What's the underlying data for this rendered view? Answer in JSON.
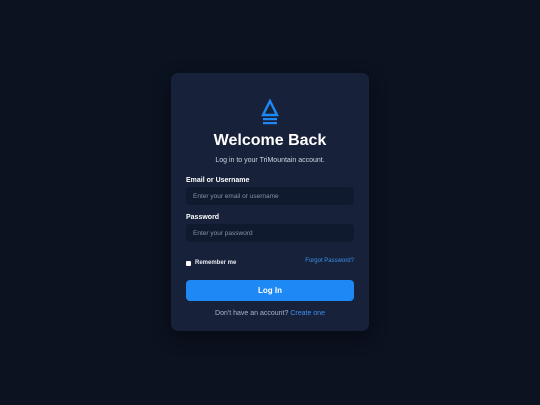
{
  "app": {
    "brand_color": "#1e88f5",
    "background_color": "#0b1220",
    "card_color": "#17223a"
  },
  "header": {
    "logo_icon": "triangle-peak-icon",
    "title": "Welcome Back",
    "subtitle": "Log in to your TriMountain account."
  },
  "form": {
    "email_label": "Email or Username",
    "email_placeholder": "Enter your email or username",
    "email_value": "",
    "password_label": "Password",
    "password_placeholder": "Enter your password",
    "password_value": "",
    "remember_label": "Remember me",
    "remember_checked": false,
    "forgot_link": "Forgot Password?",
    "submit_label": "Log In"
  },
  "footer": {
    "signup_text": "Don't have an account?",
    "signup_link": "Create one"
  }
}
